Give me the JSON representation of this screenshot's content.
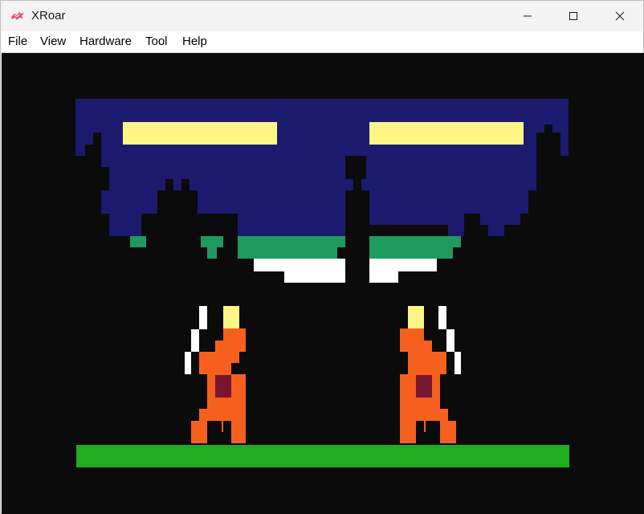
{
  "window": {
    "title": "XRoar",
    "icons": {
      "app": "xroar-dragon-icon",
      "minimize": "minimize-icon",
      "maximize": "maximize-icon",
      "close": "close-icon"
    }
  },
  "menu": {
    "items": [
      {
        "label": "File"
      },
      {
        "label": "View"
      },
      {
        "label": "Hardware"
      },
      {
        "label": "Tool"
      },
      {
        "label": "Help"
      }
    ]
  },
  "emulator": {
    "colors": {
      "background": "#0b0b0b",
      "ceiling": "#1c1a6e",
      "lights": "#fdf685",
      "moss": "#1f9a5f",
      "ice": "#ffffff",
      "skin": "#f5601f",
      "hair": "#fdf685",
      "sword": "#ffffff",
      "belt": "#7a1530",
      "ground": "#1fad1f"
    }
  }
}
